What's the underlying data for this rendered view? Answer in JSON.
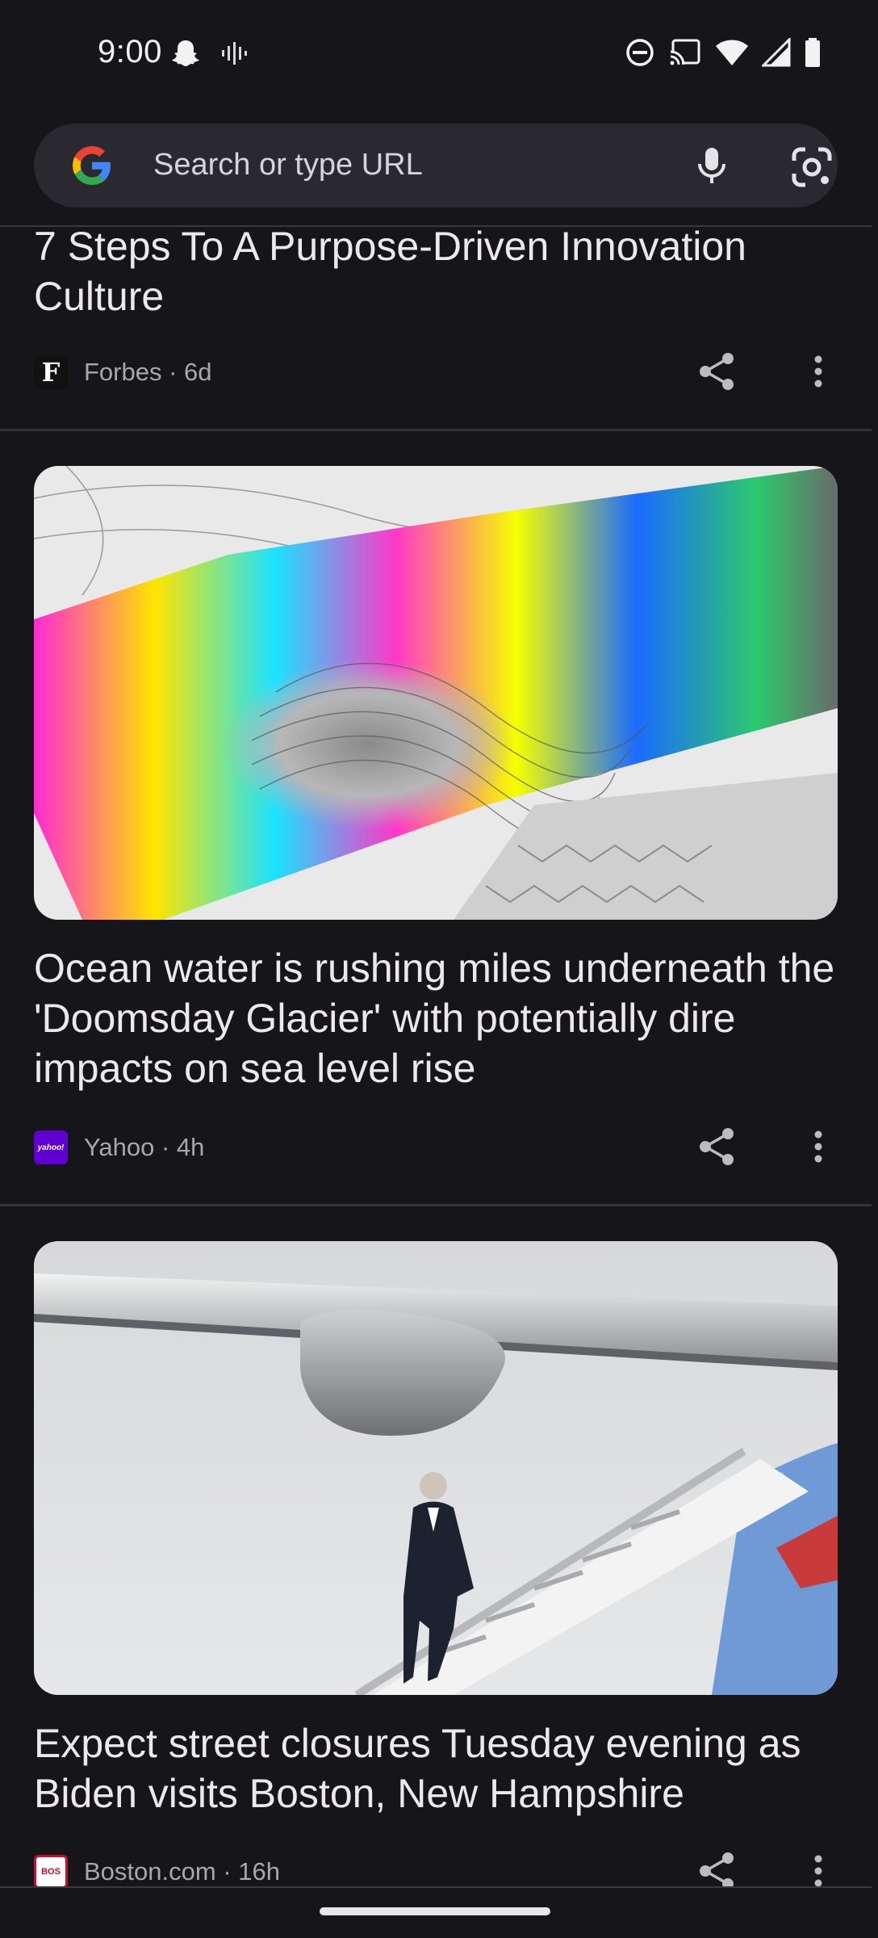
{
  "status_bar": {
    "time": "9:00",
    "left_icons": [
      "snapchat-icon",
      "audio-wave-icon"
    ],
    "right_icons": [
      "do-not-disturb-icon",
      "cast-icon",
      "wifi-icon",
      "signal-icon",
      "battery-icon"
    ]
  },
  "search": {
    "placeholder": "Search or type URL"
  },
  "feed": [
    {
      "title": "7 Steps To A Purpose-Driven Innovation Culture",
      "source": "Forbes · 6d",
      "logo_text": "F"
    },
    {
      "title": "Ocean water is rushing miles underneath the 'Doomsday Glacier' with potentially dire impacts on sea level rise",
      "source": "Yahoo · 4h",
      "logo_text": "yahoo!",
      "image": "interferometry-glacier-map"
    },
    {
      "title": "Expect street closures Tuesday evening as Biden visits Boston, New Hampshire",
      "source": "Boston.com · 16h",
      "logo_text": "BOS",
      "image": "president-descending-airplane-stairs"
    }
  ],
  "colors": {
    "background": "#16151a",
    "search_bg": "#2a2930",
    "yahoo_purple": "#6001d2",
    "boston_red": "#c8102e"
  }
}
